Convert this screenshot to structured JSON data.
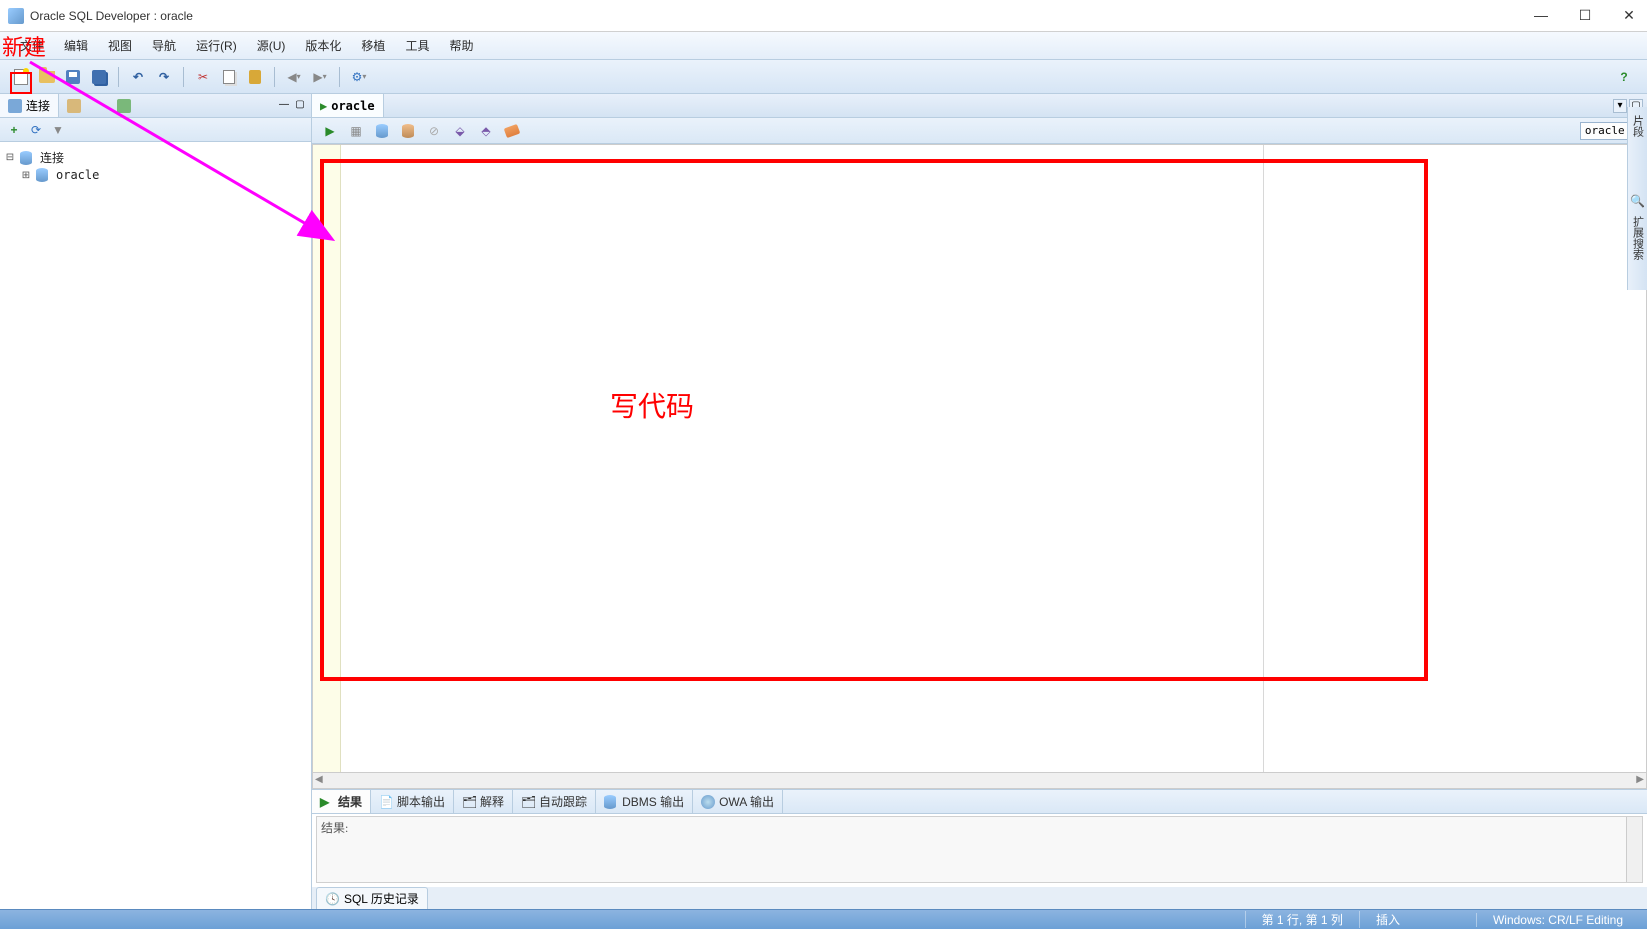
{
  "window": {
    "title": "Oracle SQL Developer : oracle"
  },
  "menu": {
    "items": [
      "文件",
      "编辑",
      "视图",
      "导航",
      "运行(R)",
      "源(U)",
      "版本化",
      "移植",
      "工具",
      "帮助"
    ]
  },
  "annotations": {
    "new_label": "新建",
    "code_label": "写代码"
  },
  "sidebar": {
    "tabs": {
      "connections": "连接"
    },
    "tree": {
      "root": "连接",
      "child": "oracle"
    }
  },
  "editor": {
    "tab_label": "oracle",
    "conn_dropdown": "oracle"
  },
  "output": {
    "tabs": [
      "结果",
      "脚本输出",
      "解释",
      "自动跟踪",
      "DBMS 输出",
      "OWA 输出"
    ],
    "result_label": "结果:"
  },
  "bottom": {
    "history_tab": "SQL 历史记录"
  },
  "right_bar": {
    "fragment": "片段",
    "ext_search": "扩展搜索"
  },
  "status": {
    "position": "第 1 行, 第 1 列",
    "mode": "插入",
    "encoding": "Windows: CR/LF Editing"
  }
}
